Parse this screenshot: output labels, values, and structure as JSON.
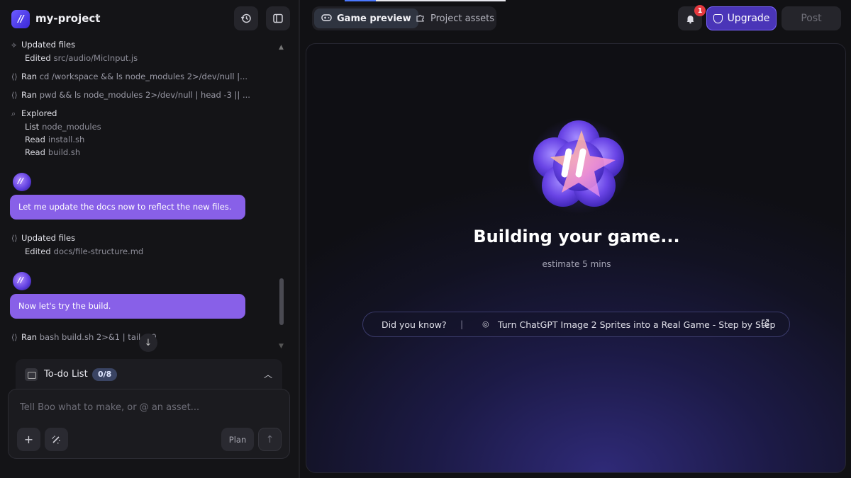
{
  "header": {
    "project_name": "my-project",
    "logo_text": "//"
  },
  "log": {
    "updated_files_1": "Updated files",
    "edited_1_key": "Edited",
    "edited_1_path": "src/audio/MicInput.js",
    "ran_1_key": "Ran",
    "ran_1_cmd": "cd /workspace && ls node_modules 2>/dev/null |...",
    "ran_2_key": "Ran",
    "ran_2_cmd": "pwd && ls node_modules 2>/dev/null | head -3 || ...",
    "explored": "Explored",
    "explored_items": [
      {
        "key": "List",
        "value": "node_modules"
      },
      {
        "key": "Read",
        "value": "install.sh"
      },
      {
        "key": "Read",
        "value": "build.sh"
      }
    ],
    "message_1": "Let me update the docs now to reflect the new files.",
    "updated_files_2": "Updated files",
    "edited_2_key": "Edited",
    "edited_2_path": "docs/file-structure.md",
    "message_2": "Now let's try the build.",
    "ran_3_key": "Ran",
    "ran_3_cmd": "bash build.sh 2>&1 | tail -40"
  },
  "todo": {
    "label": "To-do List",
    "badge": "0/8"
  },
  "composer": {
    "placeholder": "Tell Boo what to make, or @ an asset...",
    "add_label": "+",
    "plan_label": "Plan",
    "send_label": "↑"
  },
  "tabs": [
    {
      "label": "Game preview",
      "active": true
    },
    {
      "label": "Project assets",
      "active": false
    }
  ],
  "topbar": {
    "notification_count": "1",
    "upgrade_label": "Upgrade",
    "post_label": "Post"
  },
  "stage": {
    "title": "Building your game...",
    "estimate": "estimate 5 mins",
    "tip_label": "Did you know?",
    "tip_separator": "|",
    "tip_text": "Turn ChatGPT Image 2 Sprites into a Real Game - Step by Step"
  },
  "colors": {
    "accent": "#8860e8",
    "upgrade": "#4a35b8",
    "badge": "#e5393f"
  }
}
